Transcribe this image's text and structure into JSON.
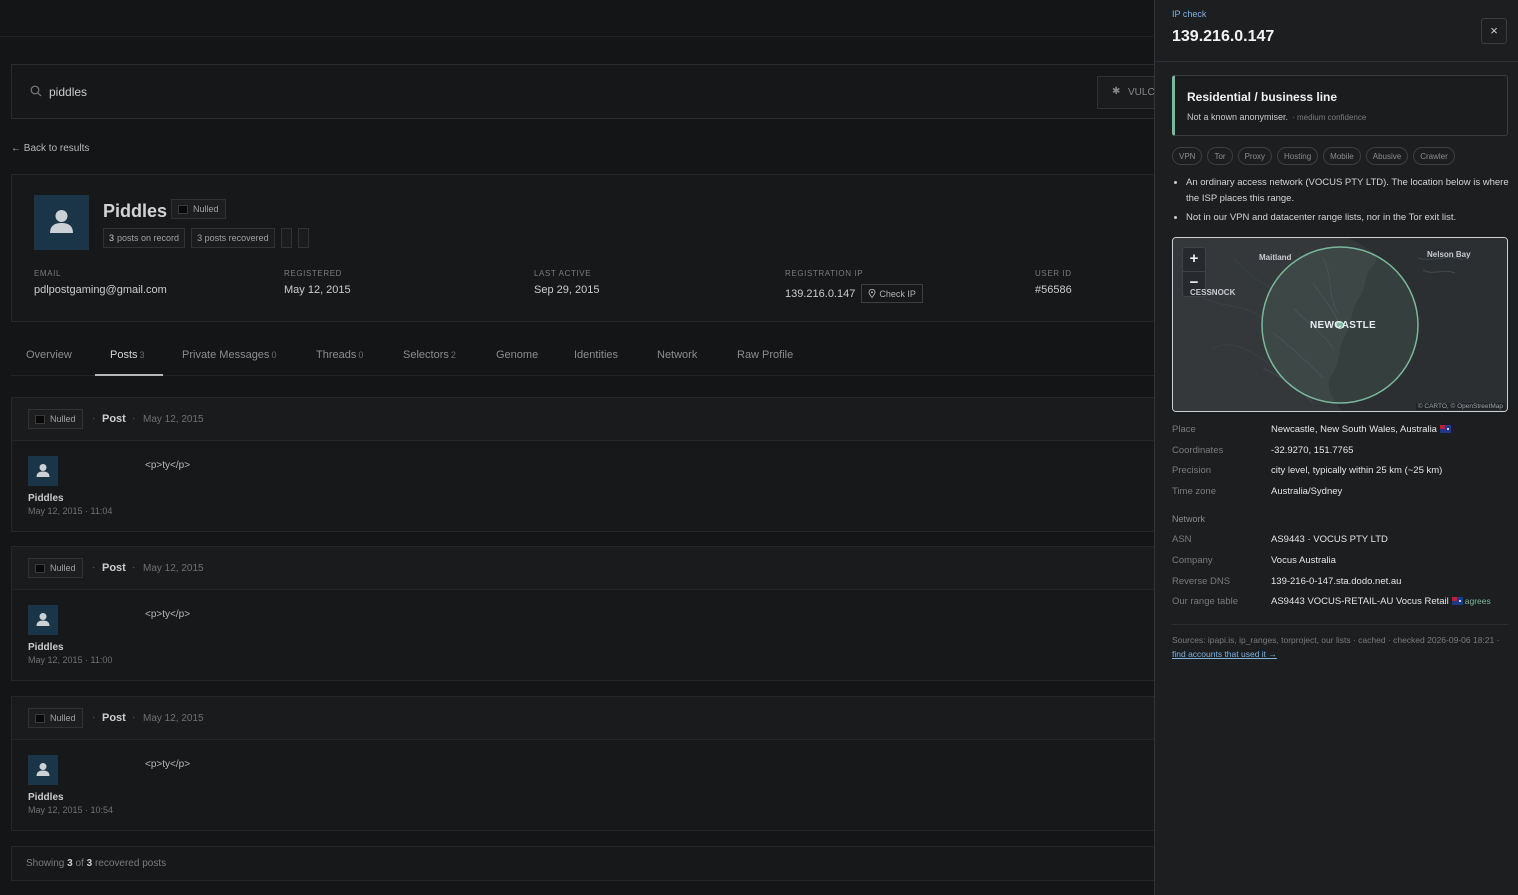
{
  "search": {
    "value": "piddles",
    "button_label": "VULC"
  },
  "back_link": "← Back to results",
  "profile": {
    "name": "Piddles",
    "source_badge": "Nulled",
    "posts_count": "3",
    "posts_label": "posts on record",
    "recovered_label": "3 posts recovered",
    "fields": {
      "email_label": "EMAIL",
      "email": "pdlpostgaming@gmail.com",
      "registered_label": "REGISTERED",
      "registered": "May 12, 2015",
      "last_active_label": "LAST ACTIVE",
      "last_active": "Sep 29, 2015",
      "reg_ip_label": "REGISTRATION IP",
      "reg_ip": "139.216.0.147",
      "check_ip_label": "Check IP",
      "user_id_label": "USER ID",
      "user_id": "#56586"
    }
  },
  "tabs": [
    {
      "label": "Overview",
      "count": ""
    },
    {
      "label": "Posts",
      "count": "3"
    },
    {
      "label": "Private Messages",
      "count": "0"
    },
    {
      "label": "Threads",
      "count": "0"
    },
    {
      "label": "Selectors",
      "count": "2"
    },
    {
      "label": "Genome",
      "count": ""
    },
    {
      "label": "Identities",
      "count": ""
    },
    {
      "label": "Network",
      "count": ""
    },
    {
      "label": "Raw Profile",
      "count": ""
    }
  ],
  "posts": [
    {
      "source": "Nulled",
      "type": "Post",
      "date": "May 12, 2015",
      "author": "Piddles",
      "time": "May 12, 2015 · 11:04",
      "body": "<p>ty</p>"
    },
    {
      "source": "Nulled",
      "type": "Post",
      "date": "May 12, 2015",
      "author": "Piddles",
      "time": "May 12, 2015 · 11:00",
      "body": "<p>ty</p>"
    },
    {
      "source": "Nulled",
      "type": "Post",
      "date": "May 12, 2015",
      "author": "Piddles",
      "time": "May 12, 2015 · 10:54",
      "body": "<p>ty</p>"
    }
  ],
  "footer": {
    "prefix": "Showing",
    "shown": "3",
    "of": "of",
    "total": "3",
    "suffix": "recovered posts"
  },
  "panel": {
    "kicker": "IP check",
    "ip": "139.216.0.147",
    "close": "×",
    "verdict_title": "Residential / business line",
    "verdict_sub": "Not a known anonymiser.",
    "confidence": "· medium confidence",
    "chips": [
      "VPN",
      "Tor",
      "Proxy",
      "Hosting",
      "Mobile",
      "Abusive",
      "Crawler"
    ],
    "bullets": [
      "An ordinary access network (VOCUS PTY LTD). The location below is where the ISP places this range.",
      "Not in our VPN and datacenter range lists, nor in the Tor exit list."
    ],
    "map": {
      "zoom_in": "+",
      "zoom_out": "−",
      "labels": {
        "maitland": "Maitland",
        "nelson_bay": "Nelson Bay",
        "cessnock": "CESSNOCK",
        "newcastle": "NEWCASTLE"
      },
      "attribution": "© CARTO, © OpenStreetMap"
    },
    "location": [
      {
        "k": "Place",
        "v": "Newcastle, New South Wales, Australia"
      },
      {
        "k": "Coordinates",
        "v": "-32.9270, 151.7765"
      },
      {
        "k": "Precision",
        "v": "city level, typically within 25 km (~25 km)"
      },
      {
        "k": "Time zone",
        "v": "Australia/Sydney"
      }
    ],
    "network_header": "Network",
    "network": [
      {
        "k": "ASN",
        "v": "AS9443 · VOCUS PTY LTD"
      },
      {
        "k": "Company",
        "v": "Vocus Australia"
      },
      {
        "k": "Reverse DNS",
        "v": "139-216-0-147.sta.dodo.net.au"
      },
      {
        "k": "Our range table",
        "v": "AS9443 VOCUS-RETAIL-AU Vocus Retail",
        "agree": "agrees"
      }
    ],
    "sources": "Sources: ipapi.is, ip_ranges, torproject, our lists · cached · checked 2026-09-06 18:21 ·",
    "sources_link": "find accounts that used it →"
  },
  "colors": {
    "accent_green": "#7bb89a",
    "link_blue": "#7fb3e0",
    "avatar_bg": "#1f3d53"
  }
}
